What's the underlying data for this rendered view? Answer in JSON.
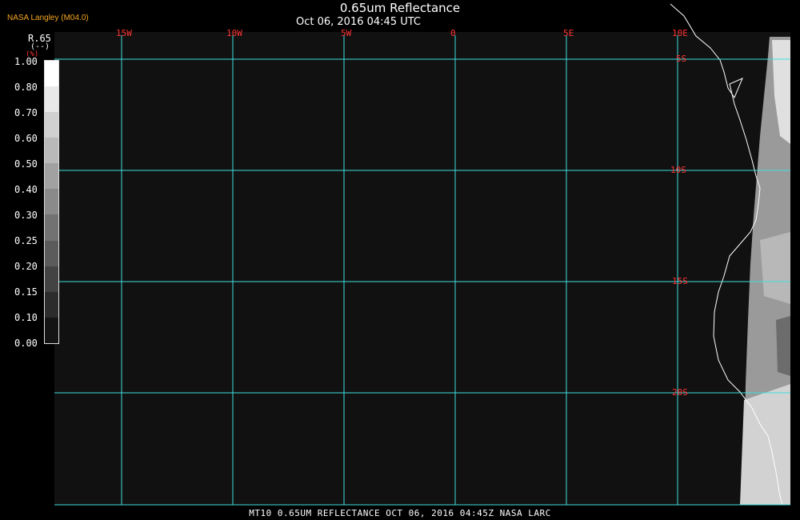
{
  "header": {
    "title": "0.65um Reflectance",
    "subtitle": "Oct 06, 2016 04:45 UTC",
    "producer": "NASA Langley (M04.0)"
  },
  "footer": {
    "caption": "MT10  0.65UM REFLECTANCE   OCT 06, 2016 04:45Z   NASA LARC"
  },
  "map": {
    "longitude_labels": [
      "15W",
      "10W",
      "5W",
      "0",
      "5E",
      "10E"
    ],
    "latitude_labels": [
      "5S",
      "10S",
      "15S",
      "20S"
    ],
    "grid_color": "#40e0e0",
    "label_color": "#ff3333",
    "background_color": "#111111"
  },
  "legend": {
    "variable": "R.65",
    "unit_line": "(--)",
    "unit_extra": "(%)",
    "ticks": [
      "1.00",
      "0.80",
      "0.70",
      "0.60",
      "0.50",
      "0.40",
      "0.30",
      "0.25",
      "0.20",
      "0.15",
      "0.10",
      "0.00"
    ]
  }
}
